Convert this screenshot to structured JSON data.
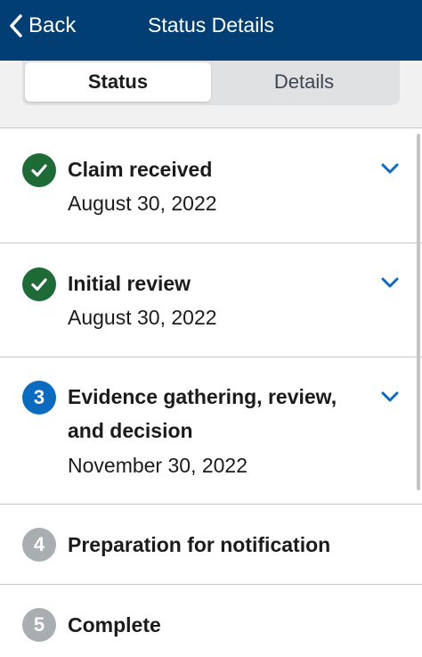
{
  "header": {
    "back_label": "Back",
    "title": "Status Details",
    "background": "#003e73"
  },
  "tabs": [
    {
      "label": "Status",
      "active": true
    },
    {
      "label": "Details",
      "active": false
    }
  ],
  "steps": [
    {
      "number": "1",
      "state": "complete",
      "title": "Claim received",
      "date": "August 30, 2022",
      "icon": "check-icon"
    },
    {
      "number": "2",
      "state": "complete",
      "title": "Initial review",
      "date": "August 30, 2022",
      "icon": "check-icon"
    },
    {
      "number": "3",
      "state": "current",
      "title_line1": "Evidence gathering, review,",
      "title_line2": "and decision",
      "date": "November 30, 2022"
    },
    {
      "number": "4",
      "state": "upcoming",
      "title": "Preparation for notification"
    },
    {
      "number": "5",
      "state": "upcoming",
      "title": "Complete"
    }
  ],
  "colors": {
    "complete": "#1e6b37",
    "current": "#0b6cbf",
    "upcoming": "#a9aeb1",
    "chevron": "#0b6cbf"
  }
}
